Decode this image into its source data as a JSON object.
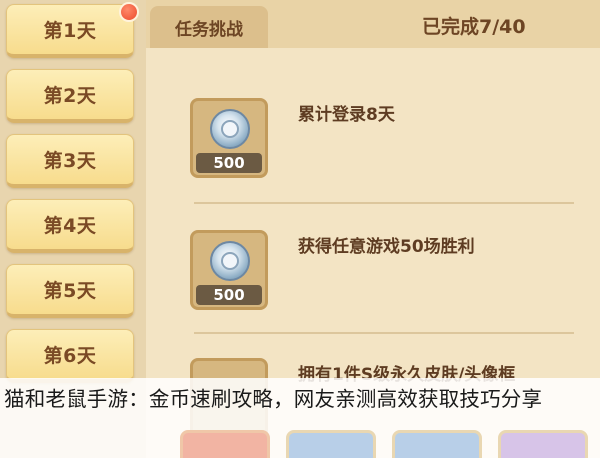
{
  "days": [
    "第1天",
    "第2天",
    "第3天",
    "第4天",
    "第5天",
    "第6天"
  ],
  "panel": {
    "tab_label": "任务挑战",
    "progress": "已完成7/40"
  },
  "tasks": [
    {
      "reward": "500",
      "label": "累计登录8天"
    },
    {
      "reward": "500",
      "label": "获得任意游戏50场胜利"
    },
    {
      "reward": "",
      "label": "拥有1件S级永久皮肤/头像框"
    }
  ],
  "caption": "猫和老鼠手游：金币速刷攻略，网友亲测高效获取技巧分享",
  "colors": {
    "tab_fill": "#f7dc8d",
    "panel_bg": "#f3e4c4",
    "notification": "#ec4a2c"
  }
}
